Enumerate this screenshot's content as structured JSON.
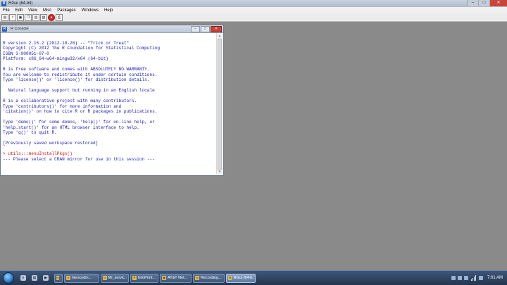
{
  "window": {
    "title": "RGui (64-bit)",
    "controls": [
      "–",
      "□",
      "✕"
    ]
  },
  "menu": [
    "File",
    "Edit",
    "View",
    "Misc",
    "Packages",
    "Windows",
    "Help"
  ],
  "toolbar": [
    {
      "name": "open-script",
      "glyph": "▤"
    },
    {
      "name": "load-workspace",
      "glyph": "⇪"
    },
    {
      "name": "save-workspace",
      "glyph": "▣"
    },
    {
      "name": "copy",
      "glyph": "❐"
    },
    {
      "name": "paste",
      "glyph": "▥"
    },
    {
      "name": "copy-paste",
      "glyph": "▧"
    },
    {
      "name": "stop",
      "glyph": "●"
    },
    {
      "name": "print",
      "glyph": "⎙"
    }
  ],
  "console": {
    "title": "R Console",
    "lines": [
      "",
      "R version 2.15.2 (2012-10-26) -- \"Trick or Treat\"",
      "Copyright (C) 2012 The R Foundation for Statistical Computing",
      "ISBN 3-900051-07-0",
      "Platform: x86_64-w64-mingw32/x64 (64-bit)",
      "",
      "R is free software and comes with ABSOLUTELY NO WARRANTY.",
      "You are welcome to redistribute it under certain conditions.",
      "Type 'license()' or 'licence()' for distribution details.",
      "",
      "  Natural language support but running in an English locale",
      "",
      "R is a collaborative project with many contributors.",
      "Type 'contributors()' for more information and",
      "'citation()' on how to cite R or R packages in publications.",
      "",
      "Type 'demo()' for some demos, 'help()' for on-line help, or",
      "'help.start()' for an HTML browser interface to help.",
      "Type 'q()' to quit R.",
      "",
      "[Previously saved workspace restored]",
      "",
      "> utils:::menuInstallPkgs()",
      "--- Please select a CRAN mirror for use in this session ---"
    ],
    "command_line_index": 22
  },
  "taskbar": {
    "quick_launch": [
      "ie",
      "explorer",
      "media"
    ],
    "tasks": [
      {
        "label": "",
        "glyph": "▭"
      },
      {
        "label": "Geocodin...",
        "glyph": "e"
      },
      {
        "label": "Mi_servic...",
        "glyph": "▭"
      },
      {
        "label": "InfoPrint...",
        "glyph": "P"
      },
      {
        "label": "AT&T Net...",
        "glyph": "◉"
      },
      {
        "label": "Recording...",
        "glyph": "◎"
      },
      {
        "label": "RGui (64-b...",
        "glyph": "R",
        "active": true
      }
    ],
    "clock": "7:01 AM"
  }
}
